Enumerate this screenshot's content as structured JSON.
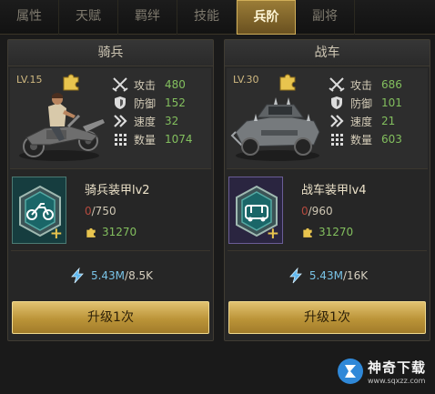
{
  "tabs": [
    {
      "label": "属性",
      "active": false
    },
    {
      "label": "天赋",
      "active": false
    },
    {
      "label": "羁绊",
      "active": false
    },
    {
      "label": "技能",
      "active": false
    },
    {
      "label": "兵阶",
      "active": true
    },
    {
      "label": "副将",
      "active": false
    }
  ],
  "panels": [
    {
      "title": "骑兵",
      "level": "LV.15",
      "stats": [
        {
          "icon": "swords-icon",
          "label": "攻击",
          "value": "480"
        },
        {
          "icon": "shield-icon",
          "label": "防御",
          "value": "152"
        },
        {
          "icon": "chevrons-icon",
          "label": "速度",
          "value": "32"
        },
        {
          "icon": "grid-dots-icon",
          "label": "数量",
          "value": "1074"
        }
      ],
      "armor": {
        "name": "骑兵装甲lv2",
        "exp_current": "0",
        "exp_total": "/750",
        "cost": "31270"
      },
      "power": {
        "current": "5.43M",
        "separator": "/",
        "required": "8.5K"
      },
      "button": "升级1次"
    },
    {
      "title": "战车",
      "level": "LV.30",
      "stats": [
        {
          "icon": "swords-icon",
          "label": "攻击",
          "value": "686"
        },
        {
          "icon": "shield-icon",
          "label": "防御",
          "value": "101"
        },
        {
          "icon": "chevrons-icon",
          "label": "速度",
          "value": "21"
        },
        {
          "icon": "grid-dots-icon",
          "label": "数量",
          "value": "603"
        }
      ],
      "armor": {
        "name": "战车装甲lv4",
        "exp_current": "0",
        "exp_total": "/960",
        "cost": "31270"
      },
      "power": {
        "current": "5.43M",
        "separator": "/",
        "required": "16K"
      },
      "button": "升级1次"
    }
  ],
  "watermark": {
    "title": "神奇下载",
    "site": "www.sqxzz.com"
  },
  "colors": {
    "accent_gold": "#c9a44f",
    "stat_green": "#83bf5e",
    "power_blue": "#79c3e6",
    "exp_red": "#b44a3e"
  }
}
